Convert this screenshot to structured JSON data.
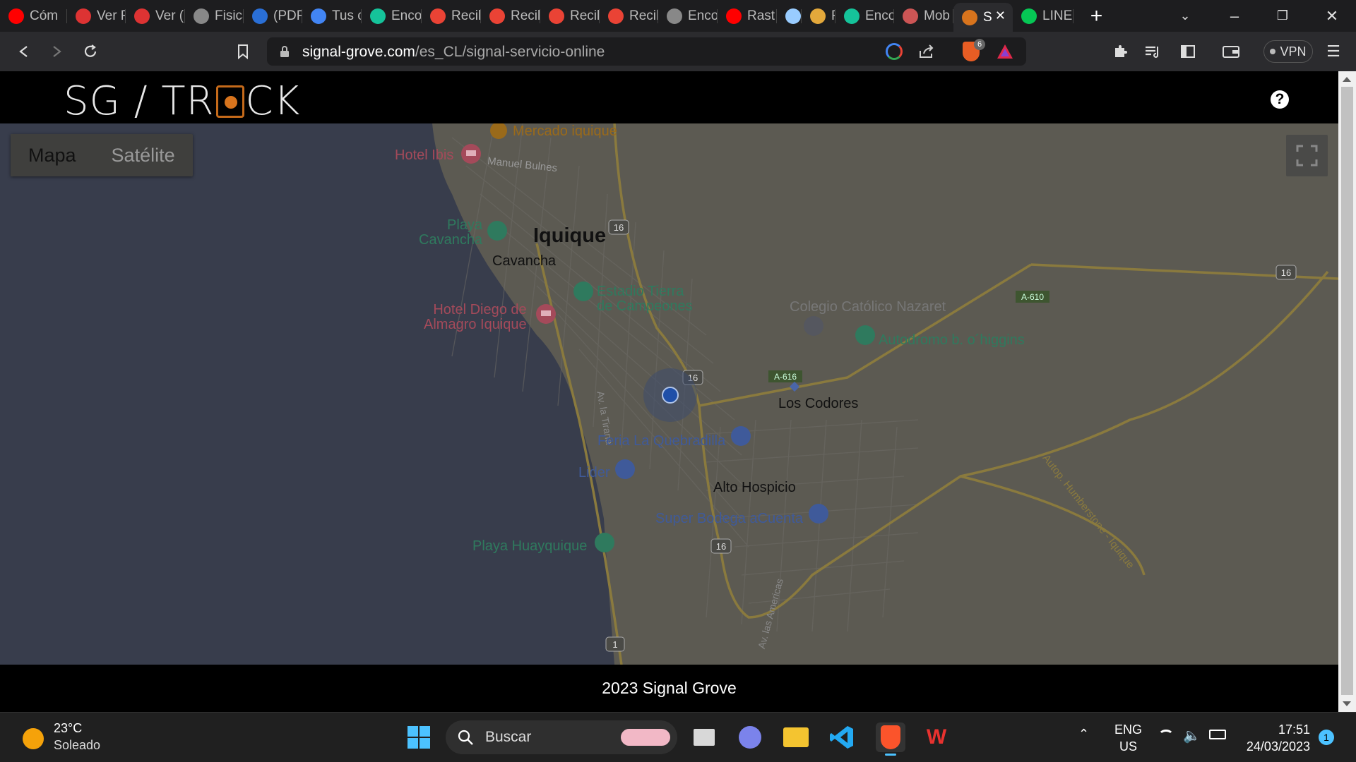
{
  "browser": {
    "tabs": [
      {
        "title": "Cóm",
        "icon": "youtube-icon",
        "color": "#ff0000"
      },
      {
        "title": "Ver F",
        "icon": "popcorn-icon",
        "color": "#d33"
      },
      {
        "title": "Ver (",
        "icon": "popcorn-icon",
        "color": "#d33"
      },
      {
        "title": "Fisica",
        "icon": "globe-icon",
        "color": "#888"
      },
      {
        "title": "(PDF",
        "icon": "document-icon",
        "color": "#2a6fd6"
      },
      {
        "title": "Tus c",
        "icon": "google-icon",
        "color": "#4285f4"
      },
      {
        "title": "Enco",
        "icon": "grammarly-icon",
        "color": "#15c39a"
      },
      {
        "title": "Recil",
        "icon": "gmail-icon",
        "color": "#ea4335"
      },
      {
        "title": "Recil",
        "icon": "gmail-icon",
        "color": "#ea4335"
      },
      {
        "title": "Recil",
        "icon": "gmail-icon",
        "color": "#ea4335"
      },
      {
        "title": "Recil",
        "icon": "gmail-icon",
        "color": "#ea4335"
      },
      {
        "title": "Enco",
        "icon": "globe-icon",
        "color": "#888"
      },
      {
        "title": "Rast",
        "icon": "youtube-icon",
        "color": "#ff0000"
      },
      {
        "title": "",
        "icon": "binoculars-icon",
        "color": "#9cf"
      },
      {
        "title": "F",
        "icon": "medal-icon",
        "color": "#e3a83b"
      },
      {
        "title": "Enco",
        "icon": "grammarly-icon",
        "color": "#15c39a"
      },
      {
        "title": "Mob",
        "icon": "map-pin-icon",
        "color": "#c55"
      },
      {
        "title": "S",
        "icon": "sg-track-icon",
        "color": "#d8741d",
        "active": true
      },
      {
        "title": "LINE",
        "icon": "line-icon",
        "color": "#06c755"
      }
    ],
    "url_host": "signal-grove.com",
    "url_path": "/es_CL/signal-servicio-online",
    "brave_badge": "6",
    "vpn_label": "VPN"
  },
  "page": {
    "logo_left": "SG / TR",
    "logo_right": "CK",
    "help_label": "?",
    "map_type": {
      "map": "Mapa",
      "satellite": "Satélite"
    },
    "footer": "2023 Signal Grove"
  },
  "map_labels": {
    "mercado": "Mercado iquique",
    "hotel_ibis": "Hotel Ibis",
    "manuel_bulnes": "Manuel Bulnes",
    "playa_cavancha": "Playa\nCavancha",
    "iquique": "Iquique",
    "cavancha": "Cavancha",
    "estadio": "Estadio Tierra\nde Campeones",
    "hotel_diego": "Hotel Diego de\nAlmagro Iquique",
    "colegio": "Colegio Católico Nazaret",
    "autodromo": "Autodromo b. o´higgins",
    "los_codores": "Los Codores",
    "feria": "Feria La Quebradilla",
    "lider": "Lider",
    "alto_hospicio": "Alto Hospicio",
    "super_bodega": "Super Bodega aCuenta",
    "playa_huayquique": "Playa Huayquique",
    "av_la_tirana": "Av. la Tirana",
    "av_las_americas": "Av. las Americas",
    "autop": "Autop. Humberstone - Iquique",
    "route_16": "16",
    "route_1": "1",
    "a610": "A-610",
    "a616": "A-616"
  },
  "taskbar": {
    "weather_temp": "23°C",
    "weather_desc": "Soleado",
    "search_placeholder": "Buscar",
    "lang_top": "ENG",
    "lang_bottom": "US",
    "time": "17:51",
    "date": "24/03/2023",
    "notifications": "1"
  }
}
